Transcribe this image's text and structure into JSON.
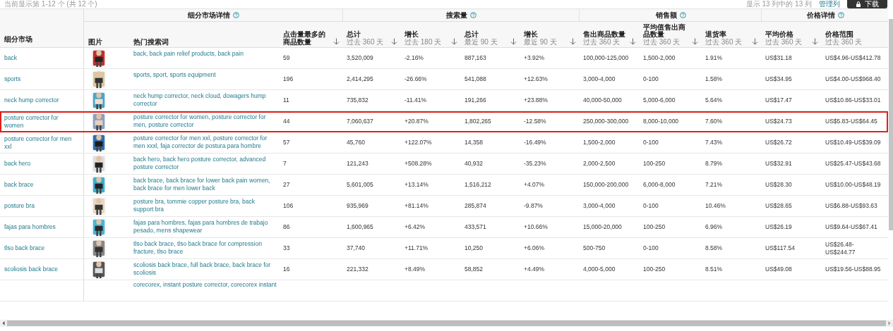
{
  "toolbar": {
    "result_count": "当前显示第 1-12 个 (共 12 个)",
    "column_count": "显示 13 列中的 13 列",
    "manage_columns": "管理列",
    "download": "下载"
  },
  "table": {
    "market_column": "细分市场",
    "groups": [
      {
        "label": "细分市场详情"
      },
      {
        "label": "搜索量"
      },
      {
        "label": "销售额"
      },
      {
        "label": "价格详情"
      }
    ],
    "columns": [
      {
        "label": "图片",
        "sortable": false
      },
      {
        "label": "热门搜索词",
        "sortable": false
      },
      {
        "label": "点击量最多的商品数量",
        "sortable": true
      },
      {
        "label": "总计",
        "sublabel": "过去 360 天",
        "sortable": true
      },
      {
        "label": "增长",
        "sublabel": "过去 180 天",
        "sortable": true
      },
      {
        "label": "总计",
        "sublabel": "最近 90 天",
        "sortable": true
      },
      {
        "label": "增长",
        "sublabel": "最近 90 天",
        "sortable": true
      },
      {
        "label": "售出商品数量",
        "sublabel": "过去 360 天",
        "sortable": true
      },
      {
        "label": "平均值售出商品数量",
        "sublabel": "过去 360 天",
        "sortable": true
      },
      {
        "label": "退货率",
        "sublabel": "过去 360 天",
        "sortable": true
      },
      {
        "label": "平均价格",
        "sublabel": "过去 360 天",
        "sortable": true
      },
      {
        "label": "价格范围",
        "sublabel": "过去 360 天",
        "sortable": false
      }
    ],
    "rows": [
      {
        "market": "back",
        "keywords": "back, back pain relief products, back pain",
        "values": [
          "59",
          "3,520,009",
          "-2.16%",
          "887,163",
          "+3.92%",
          "100,000-125,000",
          "1,500-2,000",
          "1.91%",
          "US$31.18",
          "US$4.96-US$412.78"
        ],
        "selected": false
      },
      {
        "market": "sports",
        "keywords": "sports, sport, sports equipment",
        "values": [
          "196",
          "2,414,295",
          "-26.66%",
          "541,088",
          "+12.63%",
          "3,000-4,000",
          "0-100",
          "1.58%",
          "US$34.95",
          "US$4.00-US$968.40"
        ],
        "selected": false
      },
      {
        "market": "neck hump corrector",
        "keywords": "neck hump corrector, neck cloud, dowagers hump corrector",
        "values": [
          "11",
          "735,832",
          "-11.41%",
          "191,266",
          "+23.88%",
          "40,000-50,000",
          "5,000-6,000",
          "5.64%",
          "US$17.47",
          "US$10.86-US$33.01"
        ],
        "selected": false
      },
      {
        "market": "posture corrector for women",
        "keywords": "posture corrector for women, posture corrector for men, posture corrector",
        "values": [
          "44",
          "7,060,637",
          "+20.87%",
          "1,802,265",
          "-12.58%",
          "250,000-300,000",
          "8,000-10,000",
          "7.60%",
          "US$24.73",
          "US$5.83-US$64.45"
        ],
        "selected": true
      },
      {
        "market": "posture corrector for men xxl",
        "keywords": "posture corrector for men xxl, posture corrector for men xxxl, faja corrector de postura para hombre",
        "values": [
          "57",
          "45,760",
          "+122.07%",
          "14,358",
          "-16.49%",
          "1,500-2,000",
          "0-100",
          "7.43%",
          "US$26.72",
          "US$10.49-US$39.09"
        ],
        "selected": false
      },
      {
        "market": "back hero",
        "keywords": "back hero, back hero posture corrector, advanced posture corrector",
        "values": [
          "7",
          "121,243",
          "+508.28%",
          "40,932",
          "-35.23%",
          "2,000-2,500",
          "100-250",
          "8.79%",
          "US$32.91",
          "US$25.47-US$43.68"
        ],
        "selected": false
      },
      {
        "market": "back brace",
        "keywords": "back brace, back brace for lower back pain women, back brace for men lower back",
        "values": [
          "27",
          "5,601,005",
          "+13.14%",
          "1,516,212",
          "+4.07%",
          "150,000-200,000",
          "6,000-8,000",
          "7.21%",
          "US$28.30",
          "US$10.00-US$48.19"
        ],
        "selected": false
      },
      {
        "market": "posture bra",
        "keywords": "posture bra, tommie copper posture bra, back support bra",
        "values": [
          "106",
          "935,969",
          "+81.14%",
          "285,874",
          "-9.87%",
          "3,000-4,000",
          "0-100",
          "10.46%",
          "US$28.65",
          "US$6.88-US$93.63"
        ],
        "selected": false
      },
      {
        "market": "fajas para hombres",
        "keywords": "fajas para hombres, fajas para hombres de trabajo pesado, mens shapewear",
        "values": [
          "86",
          "1,600,965",
          "+6.42%",
          "433,571",
          "+10.66%",
          "15,000-20,000",
          "100-250",
          "6.96%",
          "US$26.19",
          "US$9.64-US$67.41"
        ],
        "selected": false
      },
      {
        "market": "tlso back brace",
        "keywords": "tlso back brace, tlso back brace for compression fracture, tlso brace",
        "values": [
          "33",
          "37,740",
          "+11.71%",
          "10,250",
          "+6.06%",
          "500-750",
          "0-100",
          "8.58%",
          "US$117.54",
          "US$26.48-US$244.77"
        ],
        "selected": false
      },
      {
        "market": "scoliosis back brace",
        "keywords": "scoliosis back brace, full back brace, back brace for scoliosis",
        "values": [
          "16",
          "221,332",
          "+8.49%",
          "58,852",
          "+4.49%",
          "4,000-5,000",
          "100-250",
          "8.51%",
          "US$49.08",
          "US$19.56-US$88.95"
        ],
        "selected": false
      }
    ],
    "partial_row": {
      "keywords": "corecorex, instant posture corrector, corecorex instant"
    }
  }
}
